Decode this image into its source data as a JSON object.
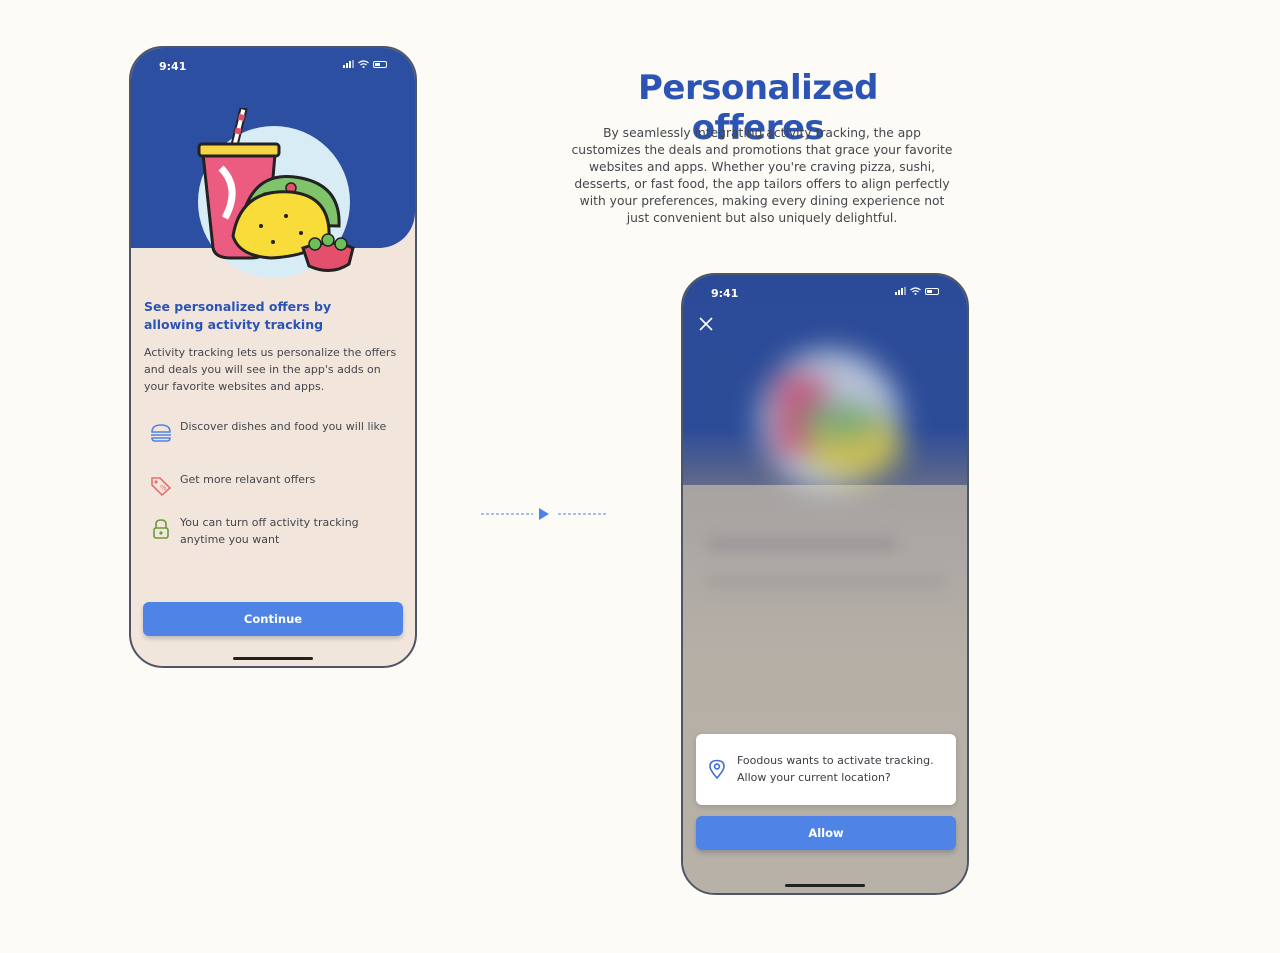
{
  "heading": "Personalized offeres",
  "intro": "By seamlessly integrating activity tracking, the app customizes the deals and promotions that grace your favorite websites and apps. Whether you're craving pizza, sushi, desserts, or fast food, the app tailors offers to align perfectly with your preferences, making every dining experience not just convenient but also uniquely delightful.",
  "phone1": {
    "status_time": "9:41",
    "title": "See personalized offers by allowing activity tracking",
    "description": "Activity tracking lets us personalize the offers and deals you will see in the app's adds on your favorite websites and apps.",
    "features": [
      {
        "text": "Discover dishes and food you will like",
        "icon": "burger-icon"
      },
      {
        "text": "Get more relavant offers",
        "icon": "price-tag-icon"
      },
      {
        "text": "You can turn off activity tracking anytime you want",
        "icon": "lock-icon"
      }
    ],
    "continue_label": "Continue"
  },
  "phone2": {
    "status_time": "9:41",
    "permission_text": "Foodous wants to activate tracking. Allow your current location?",
    "allow_label": "Allow"
  },
  "colors": {
    "brand_blue": "#2c54b4",
    "button_blue": "#4f84e6",
    "hero_blue": "#2c4fa2",
    "card_beige": "#f2e6dc"
  }
}
